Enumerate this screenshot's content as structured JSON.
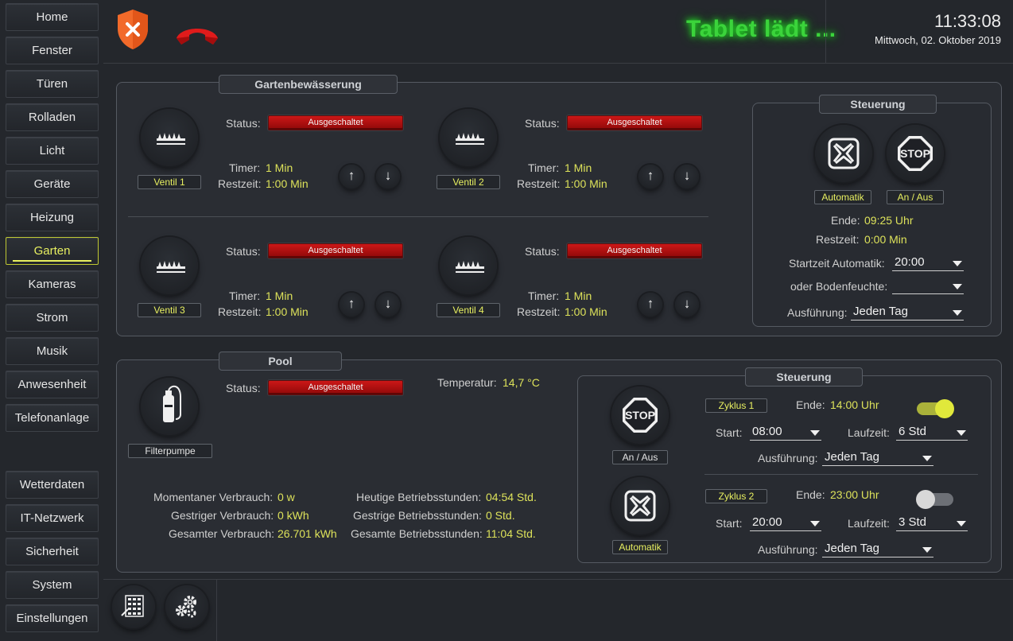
{
  "sidebar": {
    "items": [
      {
        "label": "Home"
      },
      {
        "label": "Fenster"
      },
      {
        "label": "Türen"
      },
      {
        "label": "Rolladen"
      },
      {
        "label": "Licht"
      },
      {
        "label": "Geräte"
      },
      {
        "label": "Heizung"
      },
      {
        "label": "Garten"
      },
      {
        "label": "Kameras"
      },
      {
        "label": "Strom"
      },
      {
        "label": "Musik"
      },
      {
        "label": "Anwesenheit"
      },
      {
        "label": "Telefonanlage"
      }
    ],
    "active": "Garten",
    "lower_items": [
      {
        "label": "Wetterdaten"
      },
      {
        "label": "IT-Netzwerk"
      },
      {
        "label": "Sicherheit"
      },
      {
        "label": "System"
      },
      {
        "label": "Einstellungen"
      }
    ]
  },
  "header": {
    "status_message": "Tablet lädt ...",
    "time": "11:33:08",
    "date": "Mittwoch, 02. Oktober 2019",
    "security_icon": "shield-x-icon",
    "phone_icon": "hangup-phone-icon"
  },
  "garden": {
    "title": "Gartenbewässerung",
    "valves": [
      {
        "name": "Ventil 1",
        "status_label": "Status:",
        "status": "Ausgeschaltet",
        "timer_label": "Timer:",
        "timer": "1 Min",
        "rest_label": "Restzeit:",
        "rest": "1:00 Min"
      },
      {
        "name": "Ventil 2",
        "status_label": "Status:",
        "status": "Ausgeschaltet",
        "timer_label": "Timer:",
        "timer": "1 Min",
        "rest_label": "Restzeit:",
        "rest": "1:00 Min"
      },
      {
        "name": "Ventil 3",
        "status_label": "Status:",
        "status": "Ausgeschaltet",
        "timer_label": "Timer:",
        "timer": "1 Min",
        "rest_label": "Restzeit:",
        "rest": "1:00 Min"
      },
      {
        "name": "Ventil 4",
        "status_label": "Status:",
        "status": "Ausgeschaltet",
        "timer_label": "Timer:",
        "timer": "1 Min",
        "rest_label": "Restzeit:",
        "rest": "1:00 Min"
      }
    ],
    "up_glyph": "↑",
    "down_glyph": "↓",
    "control": {
      "title": "Steuerung",
      "automatik_label": "Automatik",
      "onoff_label": "An / Aus",
      "stop_text": "STOP",
      "end_label": "Ende:",
      "end_value": "09:25 Uhr",
      "rest_label": "Restzeit:",
      "rest_value": "0:00 Min",
      "start_label": "Startzeit Automatik:",
      "start_value": "20:00",
      "moisture_label": "oder Bodenfeuchte:",
      "moisture_value": "",
      "exec_label": "Ausführung:",
      "exec_value": "Jeden Tag"
    }
  },
  "pool": {
    "title": "Pool",
    "pump_label": "Filterpumpe",
    "status_label": "Status:",
    "status": "Ausgeschaltet",
    "temp_label": "Temperatur:",
    "temp_value": "14,7 °C",
    "stats": {
      "current_label": "Momentaner Verbrauch:",
      "current_value": "0 w",
      "yesterday_label": "Gestriger Verbrauch:",
      "yesterday_value": "0 kWh",
      "total_label": "Gesamter Verbrauch:",
      "total_value": "26.701 kWh",
      "hours_today_label": "Heutige Betriebsstunden:",
      "hours_today_value": "04:54 Std.",
      "hours_yesterday_label": "Gestrige Betriebsstunden:",
      "hours_yesterday_value": "0 Std.",
      "hours_total_label": "Gesamte Betriebsstunden:",
      "hours_total_value": "11:04 Std."
    },
    "control": {
      "title": "Steuerung",
      "onoff_label": "An / Aus",
      "automatik_label": "Automatik",
      "stop_text": "STOP",
      "cycles": [
        {
          "name": "Zyklus 1",
          "end_label": "Ende:",
          "end_value": "14:00 Uhr",
          "enabled": true,
          "start_label": "Start:",
          "start_value": "08:00",
          "run_label": "Laufzeit:",
          "run_value": "6 Std",
          "exec_label": "Ausführung:",
          "exec_value": "Jeden Tag"
        },
        {
          "name": "Zyklus 2",
          "end_label": "Ende:",
          "end_value": "23:00 Uhr",
          "enabled": false,
          "start_label": "Start:",
          "start_value": "20:00",
          "run_label": "Laufzeit:",
          "run_value": "3 Std",
          "exec_label": "Ausführung:",
          "exec_value": "Jeden Tag"
        }
      ]
    }
  },
  "footer": {
    "icons": [
      "calculator-icon",
      "gears-icon"
    ]
  },
  "colors": {
    "accent": "#e8f060",
    "status_red": "#c41313",
    "loading_green": "#3bd43b",
    "background": "#24272c"
  }
}
